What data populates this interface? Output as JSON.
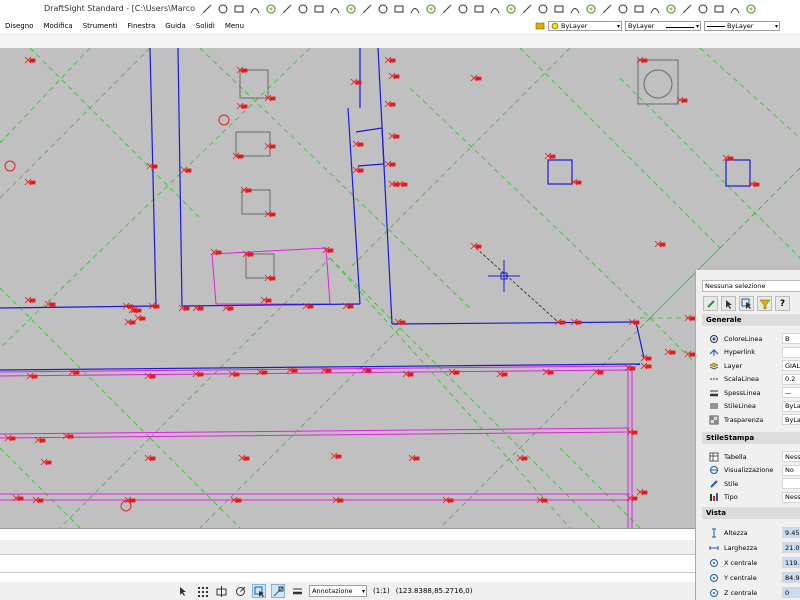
{
  "window": {
    "title": "DraftSight Standard - [C:\\Users\\Marco Sa"
  },
  "toolbar_icons": [
    "arrow-icon",
    "circle-icon",
    "line-icon",
    "polyline-icon",
    "arc-icon",
    "rectangle-icon",
    "circle-icon",
    "polygon-icon",
    "spline-icon",
    "hatch-icon",
    "block-icon",
    "text-icon",
    "dimension-icon",
    "point-icon",
    "ellipse-icon",
    "region-icon",
    "cloud-icon",
    "table-icon",
    "arrow-icon",
    "image-icon",
    "frame-icon",
    "snap-icon",
    "grid-icon",
    "ortho-icon",
    "polar-icon",
    "esnap-icon",
    "etrack-icon",
    "zoom-icon",
    "pan-icon",
    "undo-icon",
    "redo-icon",
    "layer-icon",
    "link-icon",
    "ruler-icon",
    "grid-icon"
  ],
  "menu": [
    "Disegno",
    "Modifica",
    "Strumenti",
    "Finestra",
    "Guida",
    "Solidi",
    "Menu"
  ],
  "layerbar": {
    "color": "ByLayer",
    "linestyle": "ByLayer",
    "lineweight": "ByLayer",
    "color_swatch": "#f5e100"
  },
  "status": {
    "annotation": "Annotazione",
    "scale": "(1:1)",
    "coords": "(123.8388,85.2716,0)"
  },
  "properties": {
    "selection": "Nessuna selezione",
    "sections": {
      "general": "Generale",
      "print_style": "StileStampa",
      "view": "Vista"
    },
    "general": [
      {
        "label": "ColoreLinea",
        "value": "B",
        "icon": "color-icon"
      },
      {
        "label": "Hyperlink",
        "value": "",
        "icon": "hyperlink-icon"
      },
      {
        "label": "Layer",
        "value": "GIAL",
        "icon": "layer-icon"
      },
      {
        "label": "ScalaLinea",
        "value": "0.2",
        "icon": "line-scale-icon"
      },
      {
        "label": "SpessLinea",
        "value": "—",
        "icon": "line-weight-icon"
      },
      {
        "label": "StileLinea",
        "value": "ByLay",
        "icon": "line-style-icon"
      },
      {
        "label": "Trasparenza",
        "value": "ByLay",
        "icon": "transparency-icon"
      }
    ],
    "print_style": [
      {
        "label": "Tabella",
        "value": "Nesso",
        "icon": "table-icon"
      },
      {
        "label": "Visualizzazione",
        "value": "No",
        "icon": "view-icon"
      },
      {
        "label": "Stile",
        "value": "",
        "icon": "style-icon"
      },
      {
        "label": "Tipo",
        "value": "Nesso",
        "icon": "type-icon"
      }
    ],
    "view": [
      {
        "label": "Altezza",
        "value": "9.450",
        "icon": "height-icon"
      },
      {
        "label": "Larghezza",
        "value": "21.00",
        "icon": "width-icon"
      },
      {
        "label": "X centrale",
        "value": "119.3",
        "icon": "x-center-icon"
      },
      {
        "label": "Y centrale",
        "value": "84.90",
        "icon": "y-center-icon"
      },
      {
        "label": "Z centrale",
        "value": "0",
        "icon": "z-center-icon"
      }
    ]
  }
}
